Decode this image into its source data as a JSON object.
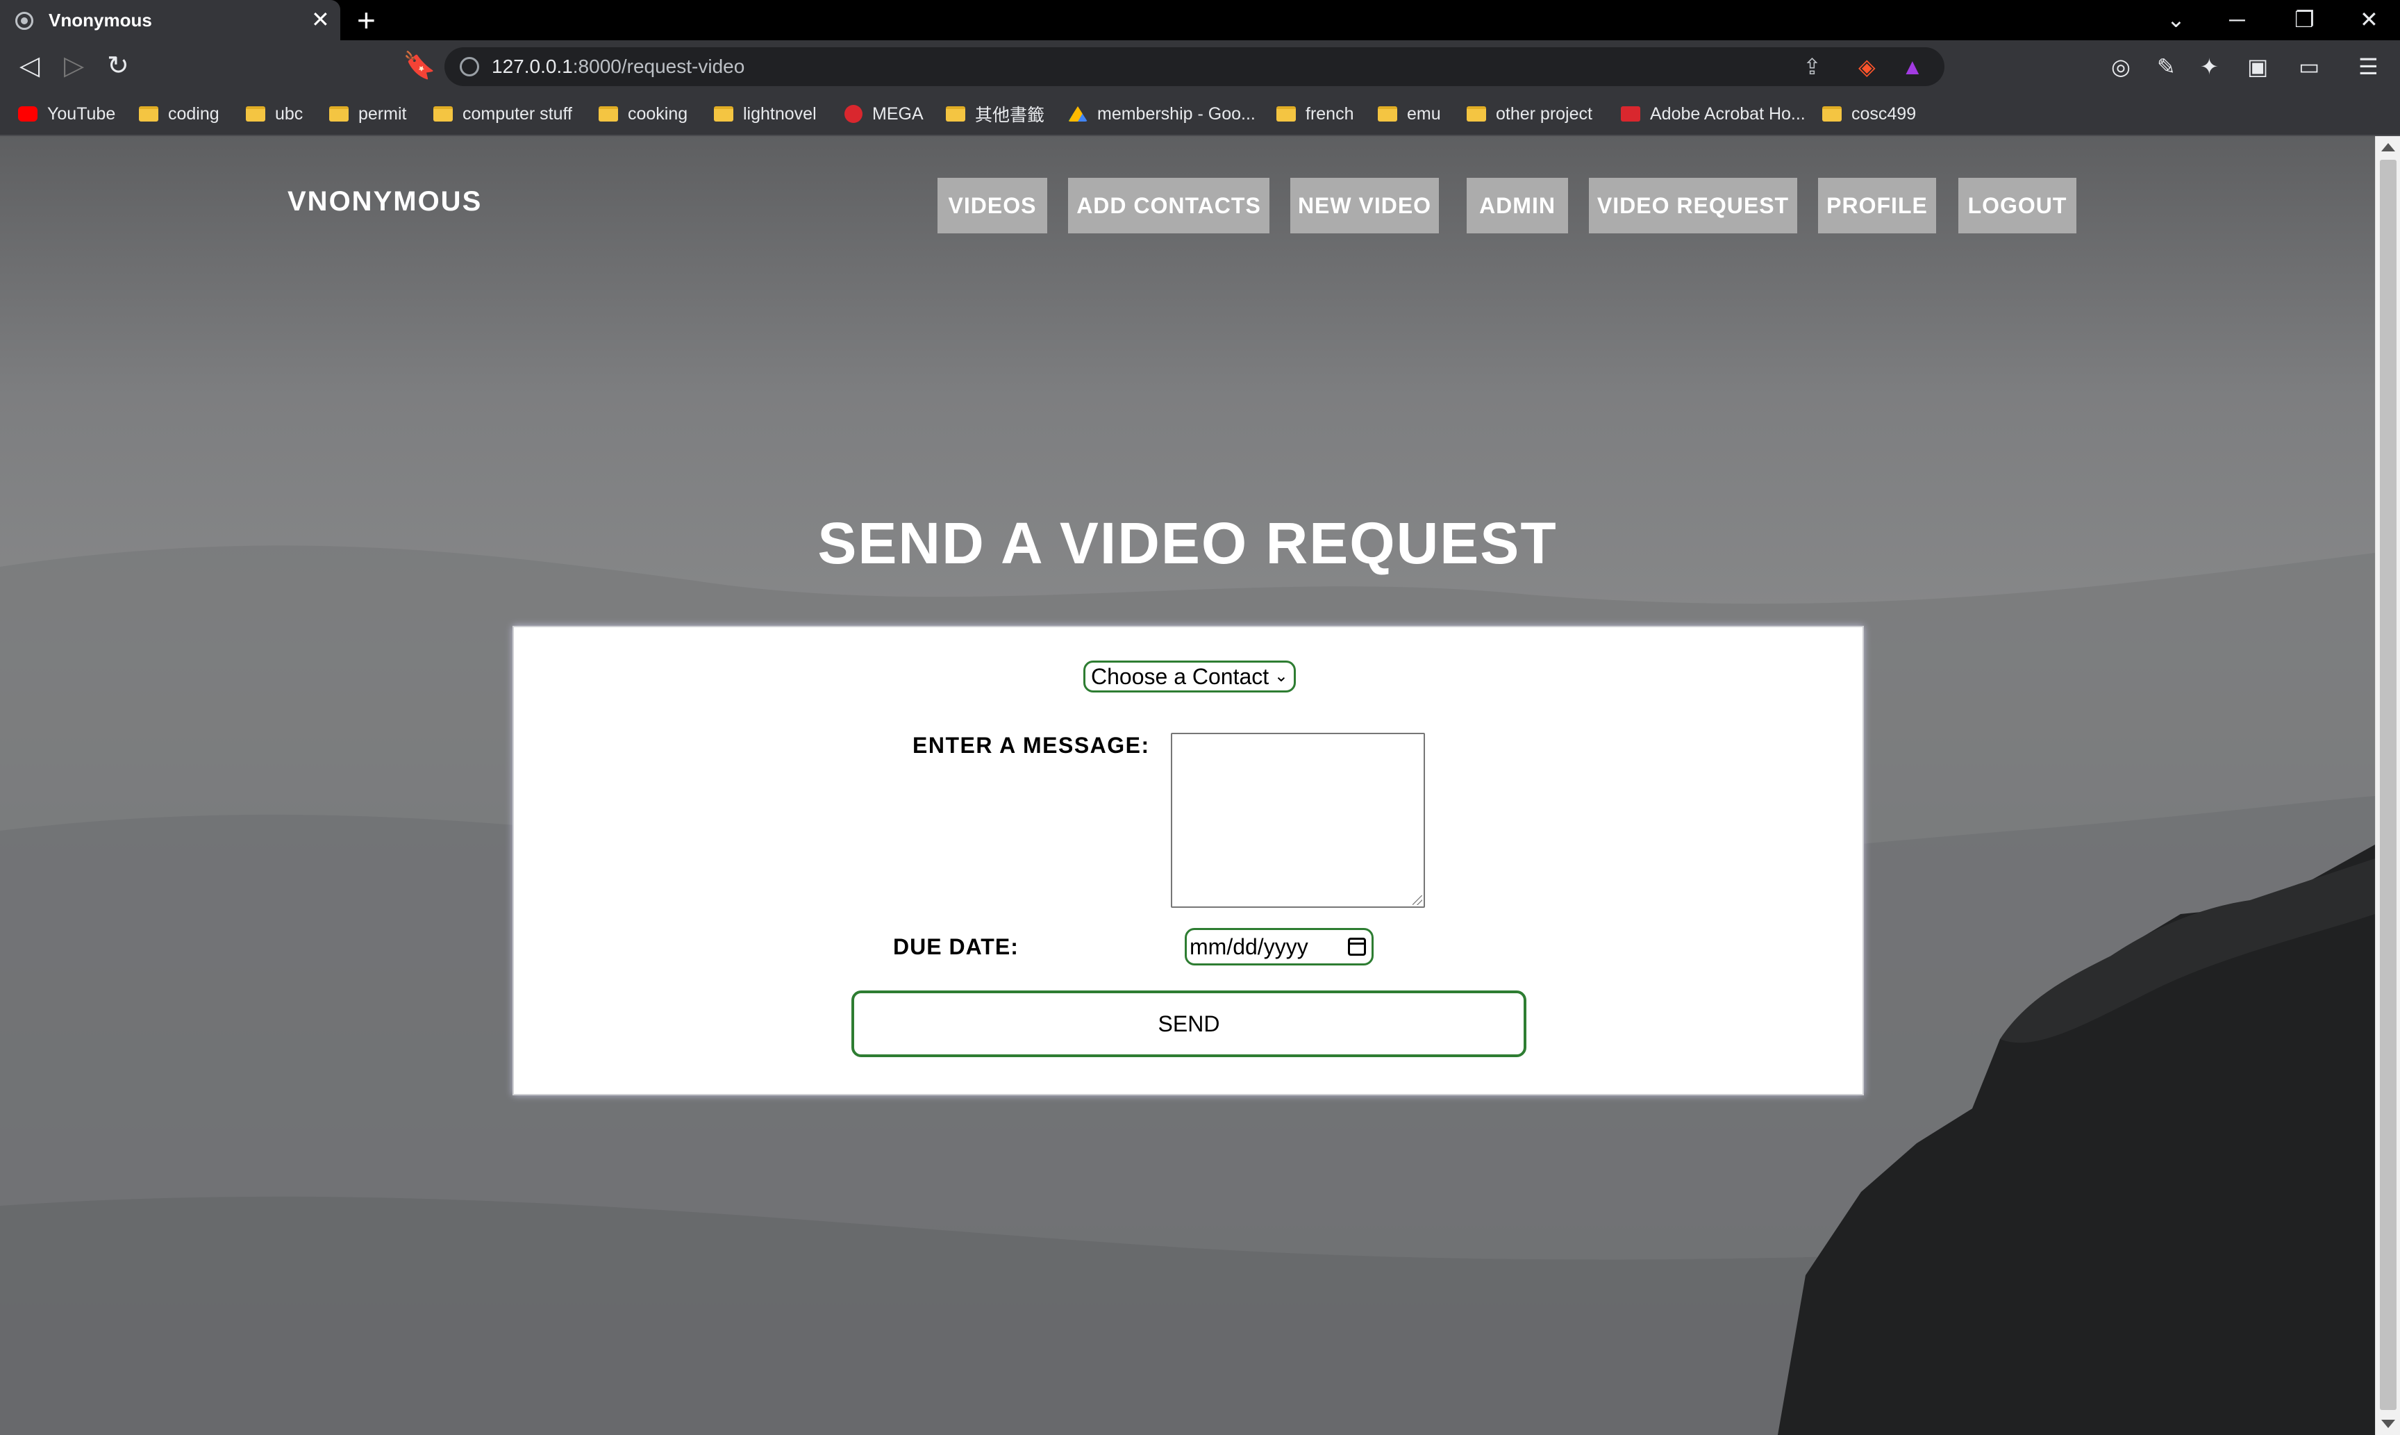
{
  "browser": {
    "tab_title": "Vnonymous",
    "tab_close": "✕",
    "new_tab": "+",
    "url_host": "127.0.0.1",
    "url_rest": ":8000/request-video",
    "icons": [
      "back-icon",
      "forward-icon",
      "reload-icon",
      "bookmark-icon",
      "site-info-icon",
      "share-icon",
      "brave-shield-icon",
      "brave-rewards-icon",
      "extension-icon",
      "sidebar-icon",
      "wallet-icon",
      "menu-icon"
    ]
  },
  "bookmarks": [
    {
      "label": "YouTube",
      "icon": "youtube"
    },
    {
      "label": "coding",
      "icon": "folder"
    },
    {
      "label": "ubc",
      "icon": "folder"
    },
    {
      "label": "permit",
      "icon": "folder"
    },
    {
      "label": "computer stuff",
      "icon": "folder"
    },
    {
      "label": "cooking",
      "icon": "folder"
    },
    {
      "label": "lightnovel",
      "icon": "folder"
    },
    {
      "label": "MEGA",
      "icon": "mega"
    },
    {
      "label": "其他書籤",
      "icon": "folder"
    },
    {
      "label": "membership - Goo...",
      "icon": "drive"
    },
    {
      "label": "french",
      "icon": "folder"
    },
    {
      "label": "emu",
      "icon": "folder"
    },
    {
      "label": "other project",
      "icon": "folder"
    },
    {
      "label": "Adobe Acrobat Ho...",
      "icon": "acrobat"
    },
    {
      "label": "cosc499",
      "icon": "folder"
    }
  ],
  "site": {
    "brand": "VNONYMOUS",
    "nav": [
      "VIDEOS",
      "ADD CONTACTS",
      "NEW VIDEO",
      "ADMIN",
      "VIDEO REQUEST",
      "PROFILE",
      "LOGOUT"
    ]
  },
  "form": {
    "heading": "SEND A VIDEO REQUEST",
    "contact_select": "Choose a Contact",
    "message_label": "ENTER A MESSAGE:",
    "message_value": "",
    "due_label": "DUE DATE:",
    "date_placeholder": "mm/dd/yyyy",
    "send_label": "SEND"
  },
  "colors": {
    "accent_green": "#2e7d32",
    "nav_button_bg": "#b4b4b4"
  }
}
